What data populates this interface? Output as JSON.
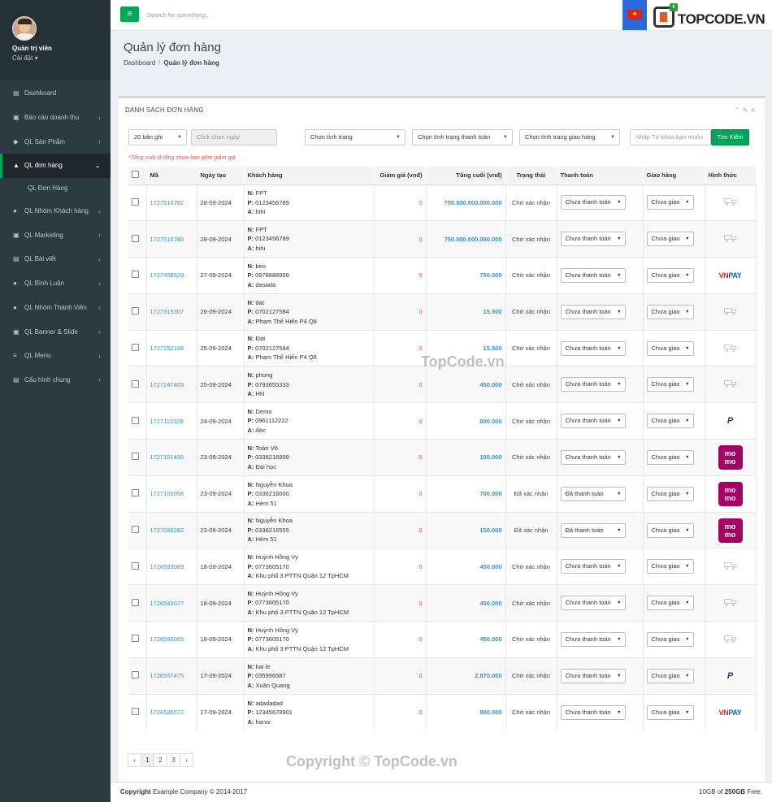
{
  "profile": {
    "name": "Quản trị viên",
    "sub": "Cài đặt"
  },
  "menu": [
    {
      "icon": "dashboard-icon",
      "glyph": "▤",
      "label": "Dashboard",
      "arrow": false,
      "active": false
    },
    {
      "icon": "report-icon",
      "glyph": "▣",
      "label": "Báo cáo doanh thu",
      "arrow": true,
      "active": false
    },
    {
      "icon": "cube-icon",
      "glyph": "◆",
      "label": "QL Sản Phẩm",
      "arrow": true,
      "active": false
    },
    {
      "icon": "shopping-bag-icon",
      "glyph": "▲",
      "label": "QL đơn hàng",
      "arrow": true,
      "active": true
    },
    {
      "icon": "user-icon",
      "glyph": "●",
      "label": "QL Nhóm Khách hàng",
      "arrow": true,
      "active": false
    },
    {
      "icon": "money-icon",
      "glyph": "▣",
      "label": "QL Marketing",
      "arrow": true,
      "active": false
    },
    {
      "icon": "article-icon",
      "glyph": "▤",
      "label": "QL Bài viết",
      "arrow": true,
      "active": false
    },
    {
      "icon": "comment-icon",
      "glyph": "●",
      "label": "QL Bình Luận",
      "arrow": true,
      "active": false
    },
    {
      "icon": "user-icon",
      "glyph": "●",
      "label": "QL Nhóm Thành Viên",
      "arrow": true,
      "active": false
    },
    {
      "icon": "image-icon",
      "glyph": "▣",
      "label": "QL Banner & Slide",
      "arrow": true,
      "active": false
    },
    {
      "icon": "list-icon",
      "glyph": "≡",
      "label": "QL Menu",
      "arrow": true,
      "active": false
    },
    {
      "icon": "file-icon",
      "glyph": "▤",
      "label": "Cấu hình chung",
      "arrow": true,
      "active": false
    }
  ],
  "submenu": {
    "label": "QL Đơn Hàng"
  },
  "topbar": {
    "search_placeholder": "Search for something...",
    "badge": "8",
    "brand_main": "TOP",
    "brand_accent": "CODE.VN"
  },
  "page": {
    "title": "Quản lý đơn hàng",
    "bc_home": "Dashboard",
    "bc_current": "Quản lý đơn hàng"
  },
  "card": {
    "title": "DANH SÁCH ĐƠN HÀNG",
    "note": "*Tổng cuối là tổng chưa bao gồm giảm giá"
  },
  "filters": {
    "per_page": "20 bản ghi",
    "date_placeholder": "Click chọn ngày",
    "status": "Chọn tình trạng",
    "pay_status": "Chọn tình trạng thanh toán",
    "ship_status": "Chọn tình trạng giao hàng",
    "keyword_placeholder": "Nhập Từ khóa bạn muốn",
    "search_btn": "Tìm Kiếm"
  },
  "columns": [
    "Mã",
    "Ngày tạo",
    "Khách hàng",
    "Giảm giá (vnđ)",
    "Tổng cuối (vnđ)",
    "Trạng thái",
    "Thanh toán",
    "Giao hàng",
    "Hình thức"
  ],
  "orders": [
    {
      "code": "1727516782",
      "date": "28-09-2024",
      "name": "FPT",
      "phone": "0123456789",
      "addr": "hihi",
      "discount": "0",
      "total": "750.000.000.000.000",
      "status": "Chờ xác nhận",
      "payment": "Chưa thanh toán",
      "shipping": "Chưa giao",
      "method": "ship"
    },
    {
      "code": "1727516780",
      "date": "28-09-2024",
      "name": "FPT",
      "phone": "0123456789",
      "addr": "hihi",
      "discount": "0",
      "total": "750.000.000.000.000",
      "status": "Chờ xác nhận",
      "payment": "Chưa thanh toán",
      "shipping": "Chưa giao",
      "method": "ship"
    },
    {
      "code": "1727408529",
      "date": "27-09-2024",
      "name": "beo",
      "phone": "0978888999",
      "addr": "dasada",
      "discount": "0",
      "total": "750.000",
      "status": "Chờ xác nhận",
      "payment": "Chưa thanh toán",
      "shipping": "Chưa giao",
      "method": "vnpay"
    },
    {
      "code": "1727315307",
      "date": "26-09-2024",
      "name": "dat",
      "phone": "0702127584",
      "addr": "Phạm Thế Hiển P4 Q8",
      "discount": "0",
      "total": "15.500",
      "status": "Chờ xác nhận",
      "payment": "Chưa thanh toán",
      "shipping": "Chưa giao",
      "method": "ship"
    },
    {
      "code": "1727252198",
      "date": "25-09-2024",
      "name": "Đạt",
      "phone": "0702127584",
      "addr": "Phạm Thế Hiển P4 Q8",
      "discount": "0",
      "total": "15.500",
      "status": "Chờ xác nhận",
      "payment": "Chưa thanh toán",
      "shipping": "Chưa giao",
      "method": "ship"
    },
    {
      "code": "1727247405",
      "date": "25-09-2024",
      "name": "phong",
      "phone": "0793655333",
      "addr": "HN",
      "discount": "0",
      "total": "450.000",
      "status": "Chờ xác nhận",
      "payment": "Chưa thanh toán",
      "shipping": "Chưa giao",
      "method": "ship"
    },
    {
      "code": "1727112328",
      "date": "24-09-2024",
      "name": "Demo",
      "phone": "0961112222",
      "addr": "Abc",
      "discount": "0",
      "total": "800.000",
      "status": "Chờ xác nhận",
      "payment": "Chưa thanh toán",
      "shipping": "Chưa giao",
      "method": "paypal"
    },
    {
      "code": "1727101436",
      "date": "23-09-2024",
      "name": "Toàn Võ",
      "phone": "0336216999",
      "addr": "Đại học",
      "discount": "0",
      "total": "150.000",
      "status": "Chờ xác nhận",
      "payment": "Chưa thanh toán",
      "shipping": "Chưa giao",
      "method": "momo"
    },
    {
      "code": "1727100058",
      "date": "23-09-2024",
      "name": "Nguyễn Khoa",
      "phone": "0336216000",
      "addr": "Hẻm 51",
      "discount": "0",
      "total": "700.000",
      "status": "Đã xác nhận",
      "payment": "Đã thanh toán",
      "shipping": "Chưa giao",
      "method": "momo"
    },
    {
      "code": "1727099282",
      "date": "23-09-2024",
      "name": "Nguyễn Khoa",
      "phone": "0336216555",
      "addr": "Hẻm 51",
      "discount": "0",
      "total": "150.000",
      "status": "Đã xác nhận",
      "payment": "Đã thanh toán",
      "shipping": "Chưa giao",
      "method": "momo"
    },
    {
      "code": "1726593089",
      "date": "18-09-2024",
      "name": "Huỳnh Hồng Vy",
      "phone": "0773605170",
      "addr": "Khu phố 3 PTTN Quận 12 TpHCM",
      "discount": "0",
      "total": "450.000",
      "status": "Chờ xác nhận",
      "payment": "Chưa thanh toán",
      "shipping": "Chưa giao",
      "method": "ship"
    },
    {
      "code": "1726593077",
      "date": "18-09-2024",
      "name": "Huỳnh Hồng Vy",
      "phone": "0773605170",
      "addr": "Khu phố 3 PTTN Quận 12 TpHCM",
      "discount": "0",
      "total": "450.000",
      "status": "Chờ xác nhận",
      "payment": "Chưa thanh toán",
      "shipping": "Chưa giao",
      "method": "ship"
    },
    {
      "code": "1726593065",
      "date": "18-09-2024",
      "name": "Huỳnh Hồng Vy",
      "phone": "0773605170",
      "addr": "Khu phố 3 PTTN Quận 12 TpHCM",
      "discount": "0",
      "total": "450.000",
      "status": "Chờ xác nhận",
      "payment": "Chưa thanh toán",
      "shipping": "Chưa giao",
      "method": "ship"
    },
    {
      "code": "1726557475",
      "date": "17-09-2024",
      "name": "hai le",
      "phone": "035996587",
      "addr": "Xuân Quang",
      "discount": "0",
      "total": "2.870.000",
      "status": "Chờ xác nhận",
      "payment": "Chưa thanh toán",
      "shipping": "Chưa giao",
      "method": "paypal"
    },
    {
      "code": "1726535572",
      "date": "17-09-2024",
      "name": "adadadad",
      "phone": "12345678901",
      "addr": "hanoi",
      "discount": "0",
      "total": "800.000",
      "status": "Chờ xác nhận",
      "payment": "Chưa thanh toán",
      "shipping": "Chưa giao",
      "method": "vnpay"
    }
  ],
  "labels": {
    "n": "N:",
    "p": "P:",
    "a": "A:",
    "vn": "VN",
    "pay": "PAY",
    "paypal": "P",
    "momo_top": "mo",
    "momo_bot": "mo"
  },
  "pager": {
    "prev": "‹",
    "pages": [
      "1",
      "2",
      "3"
    ],
    "next": "›"
  },
  "footer": {
    "copy_bold": "Copyright",
    "copy_rest": " Example Company © 2014-2017",
    "storage_pre": "10GB of ",
    "storage_bold": "250GB",
    "storage_post": " Free."
  },
  "watermarks": {
    "center": "TopCode.vn",
    "bottom": "Copyright © TopCode.vn"
  },
  "colors": {
    "accent": "#00a65a",
    "sidebar": "#2c3b41",
    "link": "#3c8dbc",
    "danger": "#dd4b39"
  }
}
